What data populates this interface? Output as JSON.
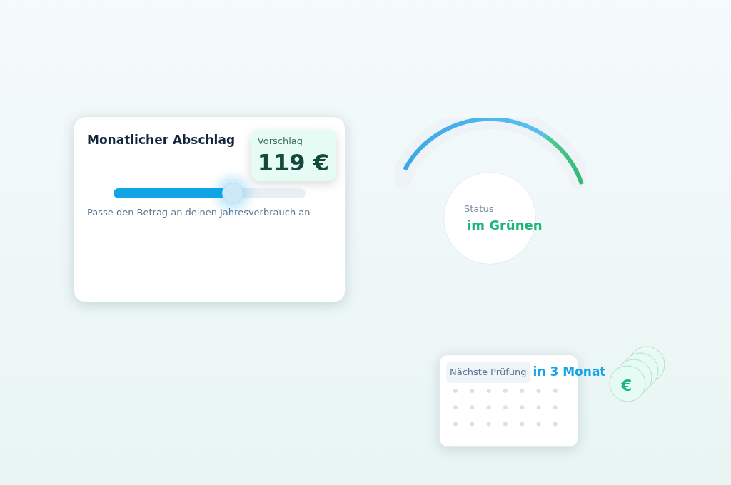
{
  "payment_card": {
    "title": "Monatlicher Abschlag",
    "suggestion": {
      "label": "Vorschlag",
      "value": "119 €"
    },
    "slider": {
      "level": 0.62
    },
    "hint": "Passe den Betrag an deinen Jahresverbrauch an"
  },
  "status": {
    "label": "Status",
    "value": "im Grünen"
  },
  "review_card": {
    "label": "Nächste Prüfung",
    "value": "in 3 Monat"
  },
  "coin": {
    "symbol": "€"
  }
}
